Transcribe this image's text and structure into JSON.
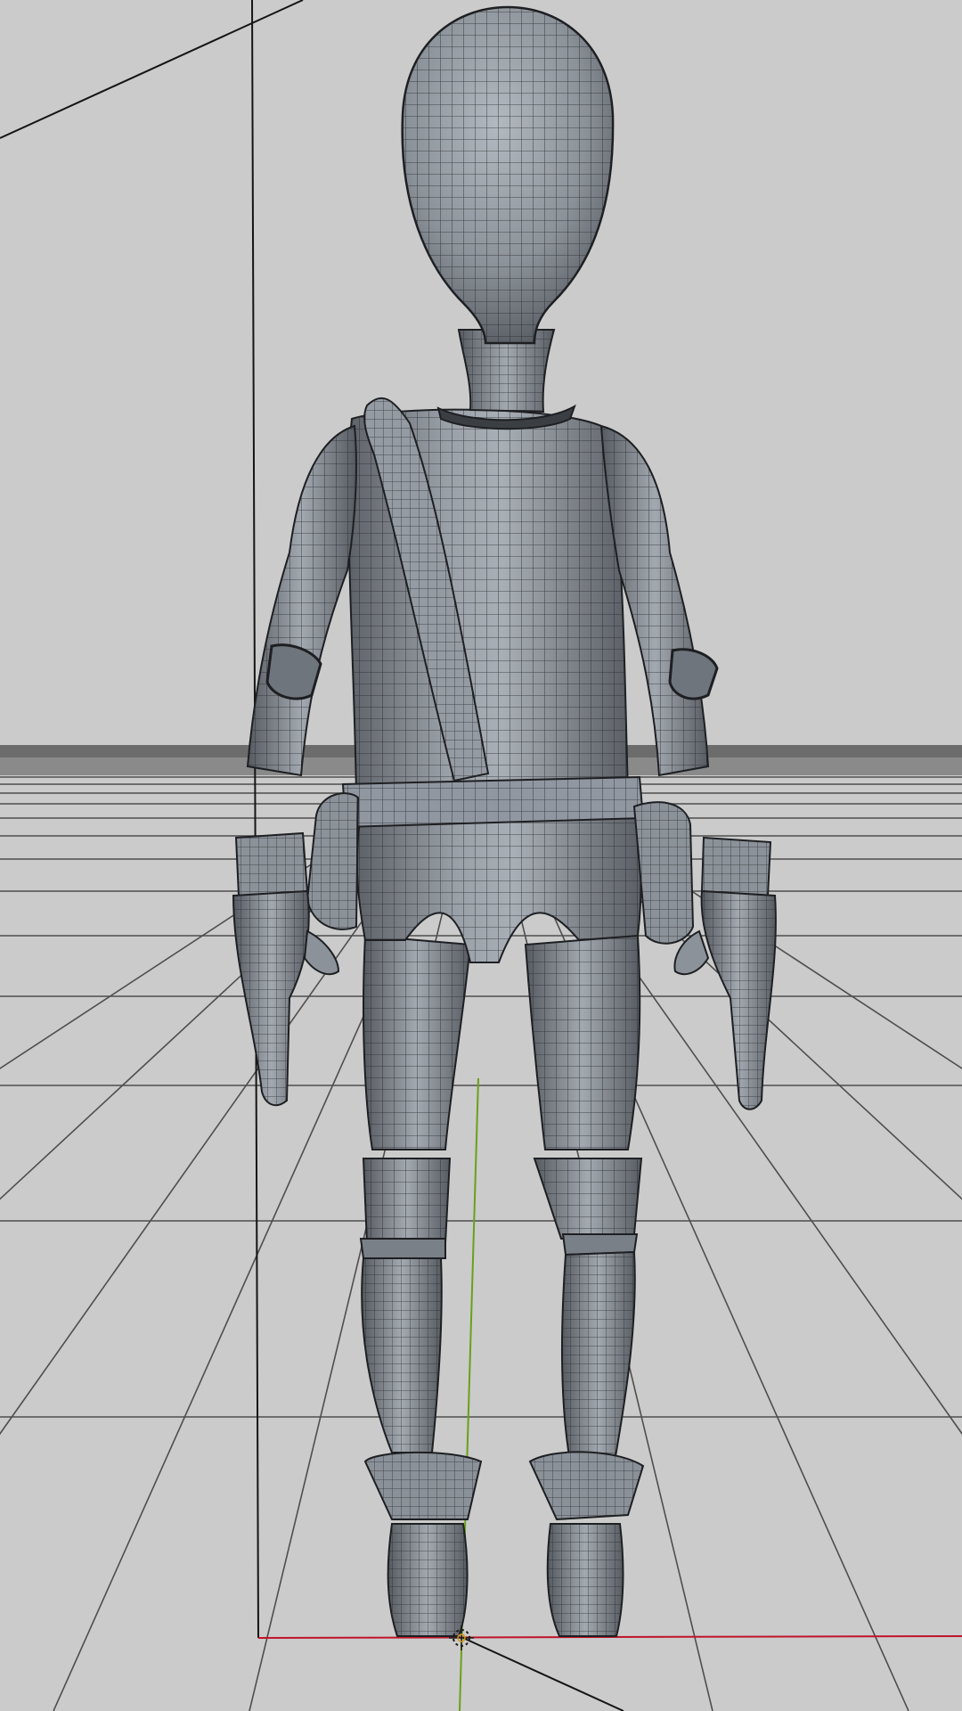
{
  "viewport": {
    "view": "3d-modeling-viewport",
    "shading": "smooth-shaded-with-wireframe",
    "object": "character-mesh",
    "background_color": "#cbcbcb",
    "mesh_color": "#8a8f96",
    "wire_color": "#2a2d31",
    "grid_color": "#5a5a5a",
    "horizon_band_color": "#6e6e6e",
    "x_axis_color": "#c0142a",
    "y_axis_color": "#6aa01a",
    "cursor_icon": "3d-cursor-icon"
  }
}
